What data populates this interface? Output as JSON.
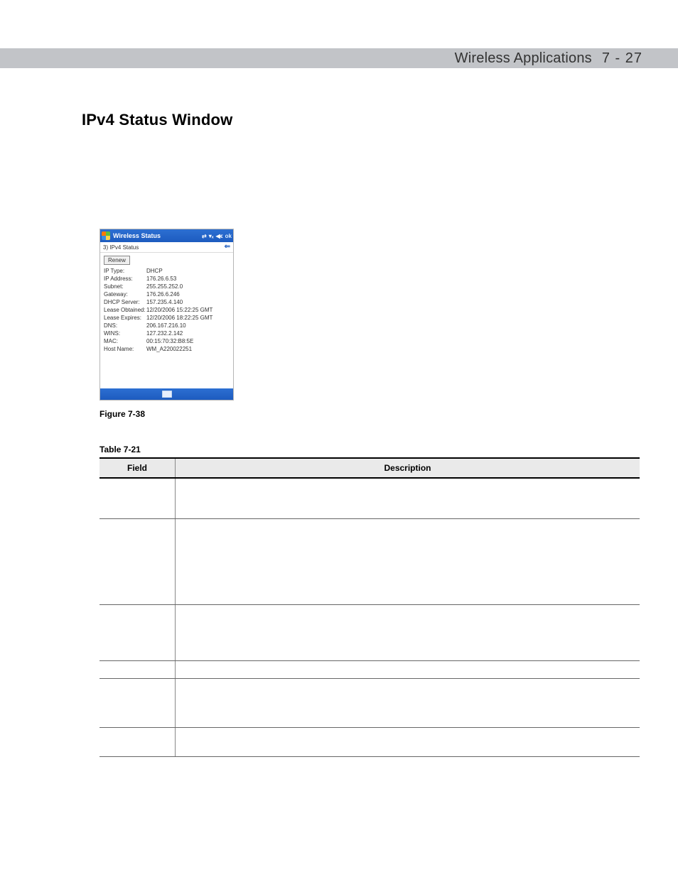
{
  "header": {
    "title": "Wireless Applications",
    "page_label": "7 - 27"
  },
  "section": {
    "heading": "IPv4 Status Window"
  },
  "screenshot": {
    "title": "Wireless Status",
    "ok_label": "ok",
    "subbar_label": "3) IPv4 Status",
    "renew_label": "Renew",
    "rows": [
      {
        "key": "IP Type:",
        "val": "DHCP"
      },
      {
        "key": "IP Address:",
        "val": "176.26.6.53"
      },
      {
        "key": "Subnet:",
        "val": "255.255.252.0"
      },
      {
        "key": "Gateway:",
        "val": "176.26.6.246"
      },
      {
        "key": "DHCP Server:",
        "val": "157.235.4.140"
      },
      {
        "key": "Lease Obtained:",
        "val": "12/20/2006 15:22:25 GMT"
      },
      {
        "key": "Lease Expires:",
        "val": "12/20/2006 18:22:25 GMT"
      },
      {
        "key": "DNS:",
        "val": "206.167.216.10"
      },
      {
        "key": "WINS:",
        "val": "127.232.2.142"
      },
      {
        "key": "MAC:",
        "val": "00:15:70:32:B8:5E"
      },
      {
        "key": "Host Name:",
        "val": "WM_A220022251"
      }
    ]
  },
  "figure_caption": "Figure 7-38",
  "table_caption": "Table 7-21",
  "table": {
    "headers": {
      "field": "Field",
      "description": "Description"
    }
  }
}
